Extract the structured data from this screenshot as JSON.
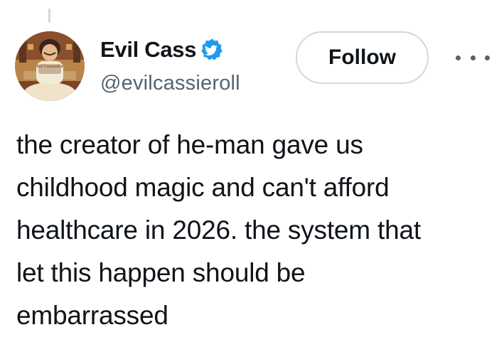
{
  "author": {
    "display_name": "Evil Cass",
    "handle": "@evilcassieroll",
    "verified": true,
    "avatar_icon": "avatar-illustration-icon",
    "verified_icon": "verified-bird-badge-icon",
    "verified_color": "#1d9bf0",
    "avatar_sign_text": "Evil Cassandra"
  },
  "actions": {
    "follow_label": "Follow",
    "more_icon": "more-horizontal-icon"
  },
  "tweet": {
    "lines": [
      "the creator of he-man gave us",
      "childhood magic and can't afford",
      "healthcare in 2026. the system that",
      "let this happen should be",
      "embarrassed"
    ]
  },
  "colors": {
    "text_primary": "#0f1419",
    "text_secondary": "#536471",
    "border": "#cfd9de"
  }
}
